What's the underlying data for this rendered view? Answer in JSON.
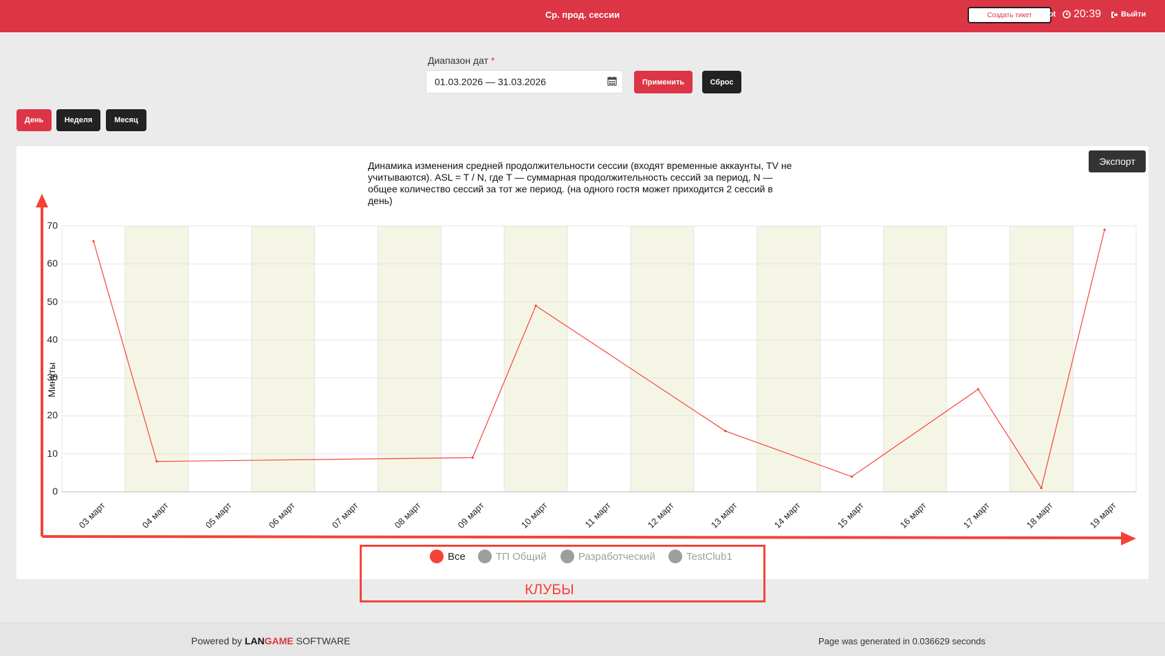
{
  "header": {
    "title": "Ср. прод. сессии",
    "create_ticket_label": "Создать тикет",
    "user": "Root",
    "clock": "20:39",
    "logout_label": "Выйти"
  },
  "filters": {
    "date_range_label": "Диапазон дат",
    "required_mark": "*",
    "date_range_value": "01.03.2026 — 31.03.2026",
    "apply_label": "Применить",
    "reset_label": "Сброс"
  },
  "period_tabs": [
    {
      "label": "День",
      "active": true
    },
    {
      "label": "Неделя",
      "active": false
    },
    {
      "label": "Месяц",
      "active": false
    }
  ],
  "export_label": "Экспорт",
  "annotation": {
    "clubs_label": "КЛУБЫ"
  },
  "colors": {
    "accent": "#dc3545",
    "line": "#f44336",
    "inactive": "#9e9e9e",
    "weekend_band": "#f5f5e6"
  },
  "chart_data": {
    "type": "line",
    "title": "Динамика изменения средней продолжительности сессии (входят временные аккаунты, TV не учитываются). ASL = T / N, где T — суммарная продолжительность сессий за период, N — общее количество сессий за тот же период. (на одного гостя может приходится 2 сессий в день)",
    "ylabel": "Минуты",
    "xlabel": "",
    "ylim": [
      0,
      70
    ],
    "yticks": [
      0,
      10,
      20,
      30,
      40,
      50,
      60,
      70
    ],
    "categories": [
      "03 март",
      "04 март",
      "05 март",
      "06 март",
      "07 март",
      "08 март",
      "09 март",
      "10 март",
      "11 март",
      "12 март",
      "13 март",
      "14 март",
      "15 март",
      "16 март",
      "17 март",
      "18 март",
      "19 март"
    ],
    "series": [
      {
        "name": "Все",
        "values": [
          66,
          8,
          null,
          null,
          null,
          null,
          9,
          49,
          null,
          null,
          16,
          null,
          4,
          null,
          27,
          1,
          69
        ]
      }
    ],
    "legend": [
      {
        "name": "Все",
        "active": true
      },
      {
        "name": "ТП Общий",
        "active": false
      },
      {
        "name": "Разработческий",
        "active": false
      },
      {
        "name": "TestClub1",
        "active": false
      }
    ],
    "legend_position": "bottom",
    "grid": true
  },
  "footer": {
    "powered_prefix": "Powered by",
    "brand_lan": "LAN",
    "brand_game": "GAME",
    "brand_suffix": "SOFTWARE",
    "generated": "Page was generated in 0.036629 seconds"
  }
}
